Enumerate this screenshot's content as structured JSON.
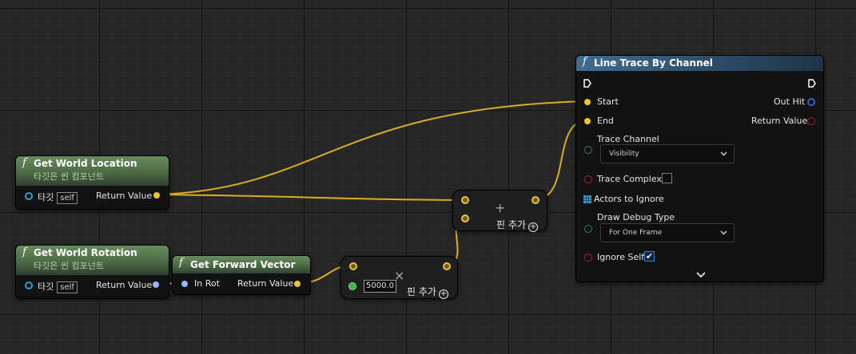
{
  "colors": {
    "exec_wire": "#ffffff",
    "vector_wire": "#f2c22a",
    "rotator_wire": "#9fb1f3",
    "function_header_green": "#4c6a45",
    "function_header_blue": "#2a4b66"
  },
  "nodes": {
    "get_world_location": {
      "icon": "function-icon",
      "title": "Get World Location",
      "subtitle": "타깃은 씬 컴포넌트",
      "target_label": "타깃",
      "target_value": "self",
      "return_label": "Return Value"
    },
    "get_world_rotation": {
      "icon": "function-icon",
      "title": "Get World Rotation",
      "subtitle": "타깃은 씬 컴포넌트",
      "target_label": "타깃",
      "target_value": "self",
      "return_label": "Return Value"
    },
    "get_forward_vector": {
      "icon": "function-icon",
      "title": "Get Forward Vector",
      "in_label": "In Rot",
      "return_label": "Return Value"
    },
    "add": {
      "symbol": "+",
      "add_pin_label": "핀 추가",
      "add_pin_icon": "⊕"
    },
    "multiply": {
      "symbol": "×",
      "float_value": "5000.0",
      "add_pin_label": "핀 추가",
      "add_pin_icon": "⊕"
    },
    "line_trace": {
      "icon": "function-icon",
      "title": "Line Trace By Channel",
      "start_label": "Start",
      "end_label": "End",
      "out_hit_label": "Out Hit",
      "return_label": "Return Value",
      "trace_channel_label": "Trace Channel",
      "trace_channel_value": "Visibility",
      "trace_complex_label": "Trace Complex",
      "trace_complex_checked": false,
      "actors_to_ignore_label": "Actors to Ignore",
      "draw_debug_label": "Draw Debug Type",
      "draw_debug_value": "For One Frame",
      "ignore_self_label": "Ignore Self",
      "ignore_self_checked": true,
      "expand_icon": "chevron-down-icon"
    }
  },
  "chevron_glyph": "⌄",
  "function_glyph": "f",
  "check_glyph": "✔"
}
